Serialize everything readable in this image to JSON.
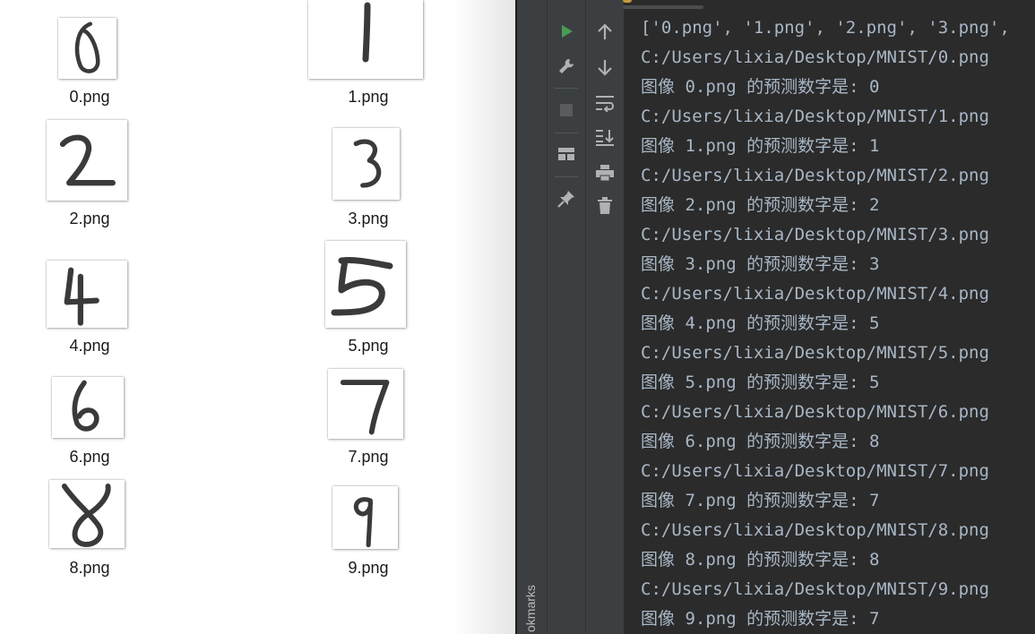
{
  "explorer": {
    "files": [
      {
        "name": "0.png",
        "digit": "0"
      },
      {
        "name": "1.png",
        "digit": "1"
      },
      {
        "name": "2.png",
        "digit": "2"
      },
      {
        "name": "3.png",
        "digit": "3"
      },
      {
        "name": "4.png",
        "digit": "4"
      },
      {
        "name": "5.png",
        "digit": "5"
      },
      {
        "name": "6.png",
        "digit": "6"
      },
      {
        "name": "7.png",
        "digit": "7"
      },
      {
        "name": "8.png",
        "digit": "8"
      },
      {
        "name": "9.png",
        "digit": "9"
      }
    ]
  },
  "ide": {
    "sidebar_label": "okmarks",
    "toolbar_icons": [
      "run-icon",
      "wrench-icon",
      "stop-icon",
      "layout-icon",
      "pin-icon",
      "arrow-up-icon",
      "arrow-down-icon",
      "soft-wrap-icon",
      "scroll-to-end-icon",
      "print-icon",
      "trash-icon"
    ],
    "colors": {
      "console_bg": "#2b2b2b",
      "console_text": "#a9b7c6",
      "toolbar_bg": "#3c3f41",
      "run_green": "#499c54"
    },
    "console_lines": [
      "['0.png', '1.png', '2.png', '3.png',",
      "C:/Users/lixia/Desktop/MNIST/0.png",
      "图像 0.png 的预测数字是: 0",
      "C:/Users/lixia/Desktop/MNIST/1.png",
      "图像 1.png 的预测数字是: 1",
      "C:/Users/lixia/Desktop/MNIST/2.png",
      "图像 2.png 的预测数字是: 2",
      "C:/Users/lixia/Desktop/MNIST/3.png",
      "图像 3.png 的预测数字是: 3",
      "C:/Users/lixia/Desktop/MNIST/4.png",
      "图像 4.png 的预测数字是: 5",
      "C:/Users/lixia/Desktop/MNIST/5.png",
      "图像 5.png 的预测数字是: 5",
      "C:/Users/lixia/Desktop/MNIST/6.png",
      "图像 6.png 的预测数字是: 8",
      "C:/Users/lixia/Desktop/MNIST/7.png",
      "图像 7.png 的预测数字是: 7",
      "C:/Users/lixia/Desktop/MNIST/8.png",
      "图像 8.png 的预测数字是: 8",
      "C:/Users/lixia/Desktop/MNIST/9.png",
      "图像 9.png 的预测数字是: 7"
    ]
  }
}
